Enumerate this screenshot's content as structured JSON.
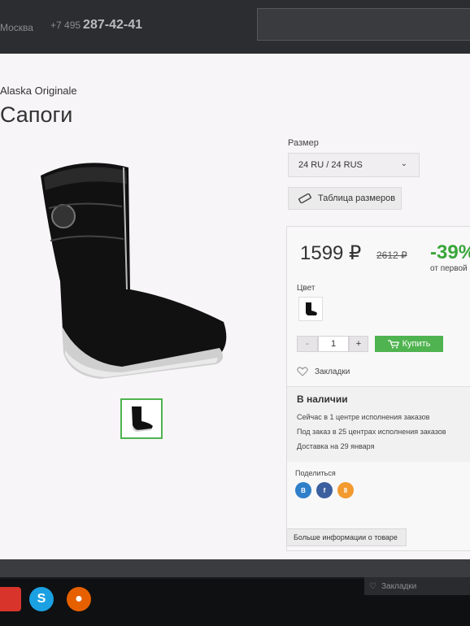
{
  "header": {
    "city": "Москва",
    "phone_prefix": "+7 495",
    "phone_number": "287-42-41"
  },
  "product": {
    "brand": "Alaska Originale",
    "title": "Сапоги",
    "size_label": "Размер",
    "size_selected": "24 RU / 24 RUS",
    "size_table_button": "Таблица размеров",
    "price": "1599 ₽",
    "old_price": "2612 ₽",
    "discount": "-39%",
    "discount_note": "от первой",
    "color_label": "Цвет",
    "quantity_minus": "-",
    "quantity": "1",
    "quantity_plus": "+",
    "buy_button": "Купить",
    "bookmarks_label": "Закладки"
  },
  "availability": {
    "title": "В наличии",
    "line1": "Сейчас в 1 центре исполнения заказов",
    "line2": "Под заказ в 25 центрах исполнения заказов",
    "line3": "Доставка на 29 января"
  },
  "share": {
    "label": "Поделиться",
    "vk": "B",
    "facebook": "f",
    "odnoklassniki": "8"
  },
  "more_info_button": "Больше информации о товаре",
  "bottom_bar": {
    "bookmarks": "Закладки"
  },
  "colors": {
    "accent_green": "#4fb34f",
    "discount_green": "#3aa63a",
    "vk_blue": "#2f7fc9",
    "fb_blue": "#3b5f9e",
    "ok_orange": "#f29a2e"
  },
  "icons": [
    "ruler-icon",
    "cart-icon",
    "heart-icon",
    "chevron-down-icon",
    "skype-icon",
    "firefox-icon"
  ]
}
